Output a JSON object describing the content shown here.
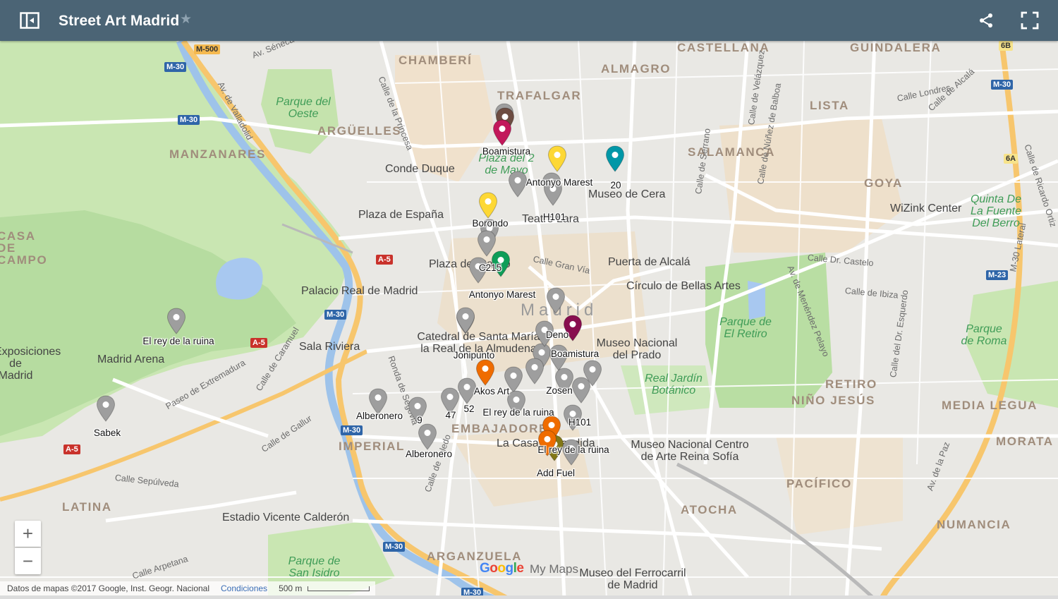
{
  "app": {
    "title": "Street Art Madrid",
    "header_color": "#4b6475"
  },
  "map": {
    "districts": [
      "CHAMBERÍ",
      "ALMAGRO",
      "CASTELLANA",
      "GUINDALERA",
      "TRAFALGAR",
      "LISTA",
      "ARGÜELLES",
      "SALAMANCA",
      "MANZANARES",
      "GOYA",
      "RETIRO",
      "NIÑO JESÚS",
      "MEDIA LEGUA",
      "MORATA",
      "IMPERIAL",
      "EMBAJADORES",
      "PACÍFICO",
      "ATOCHA",
      "LATINA",
      "NUMANCIA",
      "ARGANZUELA",
      "CASA DE CAMPO",
      "Madrid"
    ],
    "parks": [
      "Parque del Oeste",
      "Plaza del 2 de Mayo",
      "Parque de El Retiro",
      "Real Jardín Botánico",
      "Parque de Roma",
      "Quinta De La Fuente Del Berro",
      "Parque de San Isidro"
    ],
    "places": [
      "Conde Duque",
      "Museo de Cera",
      "Plaza de España",
      "Teatro Lara",
      "WiZink Center",
      "Plaza del Callao",
      "Puerta de Alcalá",
      "Círculo de Bellas Artes",
      "Palacio Real de Madrid",
      "Catedral de Santa María la Real de la Almudena",
      "Museo Nacional del Prado",
      "Sala Riviera",
      "Madrid Arena",
      "Exposiciones de Madrid",
      "La Casa Encendida",
      "Museo Nacional Centro de Arte Reina Sofía",
      "Estadio Vicente Calderón",
      "Museo del Ferrocarril de Madrid"
    ],
    "streets": [
      "Av. Séneca",
      "Av. de Valladolid",
      "Calle de la Princesa",
      "Calle de Velázquez",
      "Calle de Núñez de Balboa",
      "Calle de Serrano",
      "Calle Londres",
      "Calle de Alcalá",
      "Calle de Ricardo Ortiz",
      "Calle Gran Vía",
      "Calle Dr. Castelo",
      "Calle de Ibiza",
      "Av. de Menéndez Pelayo",
      "Calle del Dr. Esquerdo",
      "M-30 Lateral",
      "Av. de la Paz",
      "Ronda de Segovia",
      "Calle de Toledo",
      "Calle Sepúlveda",
      "Paseo de Extremadura",
      "Calle de Caramuel",
      "Calle de Gallur",
      "Calle Arpetana"
    ],
    "road_shields": [
      "M-500",
      "M-30",
      "M-30",
      "M-30",
      "M-30",
      "M-30",
      "M-30",
      "M-30",
      "M-23",
      "A-5",
      "A-5",
      "A-5",
      "6B",
      "6A"
    ],
    "pins": [
      {
        "label": "Boamistura",
        "color": "#c2185b"
      },
      {
        "label": "Antonyo Marest",
        "color": "#fdd835"
      },
      {
        "label": "20",
        "color": "#0097a7"
      },
      {
        "label": "Borondo",
        "color": "#fdd835"
      },
      {
        "label": "H101",
        "color": "#9e9e9e"
      },
      {
        "label": "C215",
        "color": "#9e9e9e"
      },
      {
        "label": "Antonyo Marest",
        "color": "#0f9d58"
      },
      {
        "label": "Deno",
        "color": "#880e4f"
      },
      {
        "label": "Boamistura",
        "color": "#9e9e9e"
      },
      {
        "label": "Jonipunto",
        "color": "#9e9e9e"
      },
      {
        "label": "Akos Art",
        "color": "#ef6c00"
      },
      {
        "label": "Zosen",
        "color": "#9e9e9e"
      },
      {
        "label": "El rey de la ruina",
        "color": "#9e9e9e"
      },
      {
        "label": "Sabek",
        "color": "#9e9e9e"
      },
      {
        "label": "Alberonero",
        "color": "#9e9e9e"
      },
      {
        "label": "47",
        "color": "#9e9e9e"
      },
      {
        "label": "52",
        "color": "#9e9e9e"
      },
      {
        "label": "El rey de la ruina",
        "color": "#9e9e9e"
      },
      {
        "label": "9",
        "color": "#9e9e9e"
      },
      {
        "label": "H101",
        "color": "#9e9e9e"
      },
      {
        "label": "Alberonero",
        "color": "#9e9e9e"
      },
      {
        "label": "El rey de la ruina",
        "color": "#ef6c00"
      },
      {
        "label": "Add Fuel",
        "color": "#9e9e9e"
      }
    ],
    "extra_pins": [
      "#9e9e9e",
      "#6d4c41",
      "#9e9e9e",
      "#9e9e9e",
      "#9e9e9e",
      "#9e9e9e",
      "#9e9e9e",
      "#9e9e9e",
      "#9e9e9e",
      "#9e9e9e",
      "#9e9e9e",
      "#9e9e9e",
      "#9e9e9e",
      "#9e9e9e",
      "#ef6c00",
      "#827717"
    ]
  },
  "controls": {
    "zoom_in": "+",
    "zoom_out": "−",
    "attribution": "Datos de mapas ©2017 Google, Inst. Geogr. Nacional",
    "terms": "Condiciones",
    "scale": "500 m",
    "google": "Google",
    "mymaps": "My Maps"
  },
  "icons": {
    "sidebar": "sidebar-toggle-icon",
    "star": "star-icon",
    "share": "share-icon",
    "fullscreen": "fullscreen-icon"
  }
}
